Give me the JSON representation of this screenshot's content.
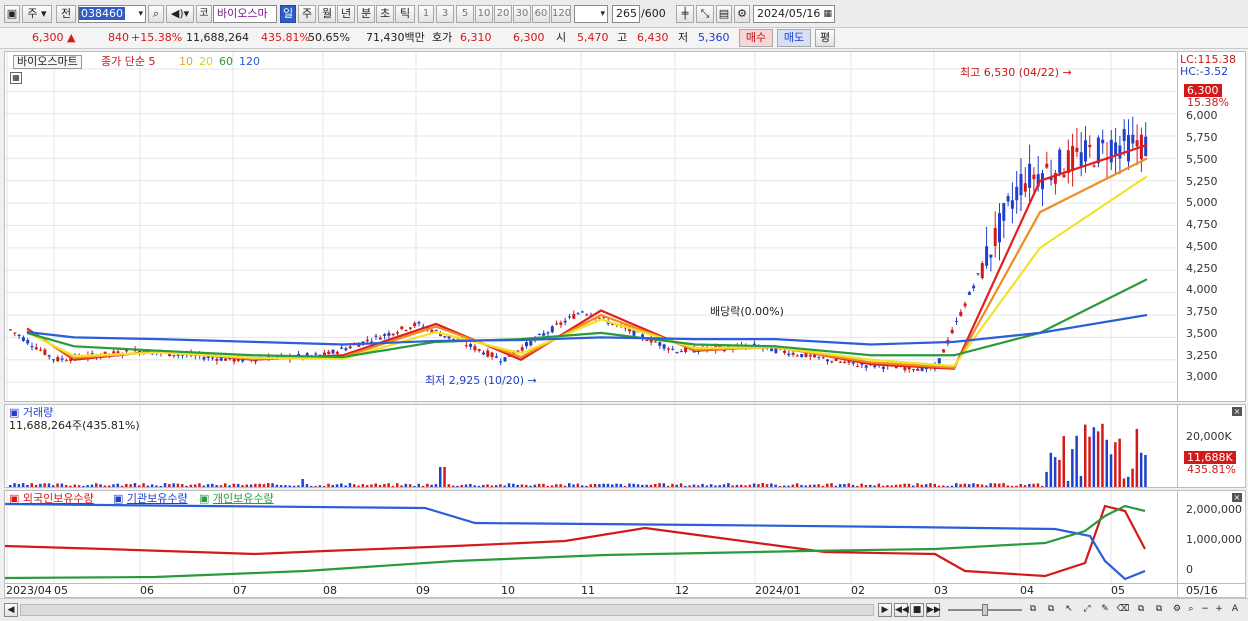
{
  "toolbar": {
    "market": "주",
    "prefix": "전",
    "code": "038460",
    "stock_name": "바이오스마",
    "market_tag": "코",
    "periods": [
      "일",
      "주",
      "월",
      "년",
      "분",
      "초",
      "틱"
    ],
    "selected_period": "일",
    "intervals": [
      "1",
      "3",
      "5",
      "10",
      "20",
      "30",
      "60",
      "120"
    ],
    "count": "265",
    "count_total": "/600",
    "date": "2024/05/16"
  },
  "info": {
    "price": "6,300",
    "change": "840",
    "change_pct": "+15.38%",
    "volume": "11,688,264",
    "volume_pct": "435.81%",
    "turnover_pct": "50.65%",
    "amount": "71,430백만",
    "ask_label": "호가",
    "ask_value": "6,310",
    "bid_value": "6,300",
    "open_label": "시",
    "open_value": "5,470",
    "high_label": "고",
    "high_value": "6,430",
    "low_label": "저",
    "low_value": "5,360",
    "buy_label": "매수",
    "sell_label": "매도",
    "eval_label": "평"
  },
  "price_panel": {
    "name": "바이오스마트",
    "ma_title": "종가 단순",
    "ma_periods": [
      "5",
      "10",
      "20",
      "60",
      "120"
    ],
    "high_note": "최고 6,530 (04/22)",
    "low_note": "최저 2,925 (10/20)",
    "dividend_note": "배당락(0.00%)",
    "lc": "LC:115.38",
    "hc": "HC:-3.52",
    "price_tag": "6,300",
    "price_tag_pct": "15.38%",
    "ticks": [
      "6,000",
      "5,750",
      "5,500",
      "5,250",
      "5,000",
      "4,750",
      "4,500",
      "4,250",
      "4,000",
      "3,750",
      "3,500",
      "3,250",
      "3,000"
    ]
  },
  "volume_panel": {
    "title": "거래량",
    "value": "11,688,264주(435.81%)",
    "tick": "20,000K",
    "tag": "11,688K",
    "tag_pct": "435.81%"
  },
  "holding_panel": {
    "series": [
      "외국인보유수량",
      "기관보유수량",
      "개인보유수량"
    ],
    "ticks": [
      "2,000,000",
      "1,000,000",
      "0"
    ]
  },
  "x_axis": {
    "labels": [
      "2023/04",
      "05",
      "06",
      "07",
      "08",
      "09",
      "10",
      "11",
      "12",
      "2024/01",
      "02",
      "03",
      "04",
      "05"
    ],
    "end_label": "05/16"
  },
  "colors": {
    "up": "#d21a1a",
    "down": "#1f3fcc",
    "ma5": "#e02020",
    "ma10": "#f08c1e",
    "ma20": "#f2e22a",
    "ma60": "#2a9a3c",
    "ma120": "#2b5ed8"
  },
  "chart_data": {
    "type": "line",
    "x": [
      "2023/04",
      "2023/05",
      "2023/06",
      "2023/07",
      "2023/08",
      "2023/09",
      "2023/10",
      "2023/11",
      "2023/12",
      "2024/01",
      "2024/02",
      "2024/03",
      "2024/04",
      "2024/05"
    ],
    "series": [
      {
        "name": "5",
        "values": [
          3600,
          3250,
          3350,
          3250,
          3300,
          3650,
          3250,
          3800,
          3350,
          3400,
          3200,
          3150,
          5250,
          5650
        ]
      },
      {
        "name": "10",
        "values": [
          3580,
          3270,
          3340,
          3260,
          3280,
          3620,
          3280,
          3750,
          3360,
          3390,
          3220,
          3160,
          4900,
          5500
        ]
      },
      {
        "name": "20",
        "values": [
          3560,
          3290,
          3330,
          3270,
          3260,
          3560,
          3320,
          3700,
          3380,
          3390,
          3250,
          3180,
          4500,
          5300
        ]
      },
      {
        "name": "60",
        "values": [
          3550,
          3400,
          3350,
          3300,
          3280,
          3450,
          3480,
          3550,
          3420,
          3400,
          3300,
          3300,
          3550,
          4150
        ]
      },
      {
        "name": "120",
        "values": [
          3560,
          3500,
          3480,
          3450,
          3420,
          3460,
          3470,
          3500,
          3480,
          3480,
          3420,
          3450,
          3550,
          3750
        ]
      }
    ],
    "ylim": [
      2800,
      6600
    ]
  }
}
